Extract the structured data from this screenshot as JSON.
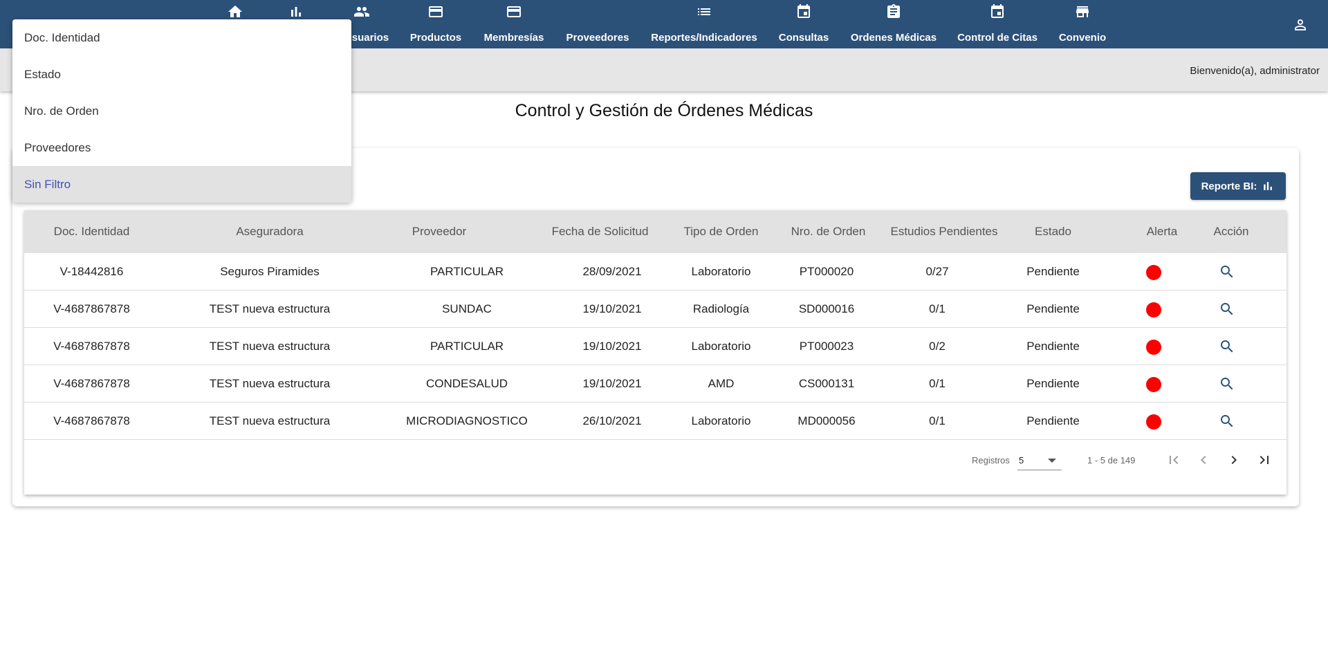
{
  "nav": {
    "items": [
      {
        "label": "",
        "icon": "home-icon"
      },
      {
        "label": "",
        "icon": "bar-chart-icon"
      },
      {
        "label": "Usuarios",
        "icon": "people-icon"
      },
      {
        "label": "Productos",
        "icon": "card-icon"
      },
      {
        "label": "Membresías",
        "icon": "card-icon"
      },
      {
        "label": "Proveedores",
        "icon": ""
      },
      {
        "label": "Reportes/Indicadores",
        "icon": "list-icon"
      },
      {
        "label": "Consultas",
        "icon": "calendar-icon"
      },
      {
        "label": "Ordenes Médicas",
        "icon": "clipboard-icon"
      },
      {
        "label": "Control de Citas",
        "icon": "calendar-icon"
      },
      {
        "label": "Convenio",
        "icon": "store-icon"
      }
    ],
    "user_icon": "person-icon"
  },
  "header": {
    "welcome": "Bienvenido(a), administrator"
  },
  "page": {
    "title": "Control y Gestión de Órdenes Médicas"
  },
  "toolbar": {
    "bi_label": "Reporte BI:"
  },
  "table": {
    "columns": [
      "Doc. Identidad",
      "Aseguradora",
      "Proveedor",
      "Fecha de Solicitud",
      "Tipo de Orden",
      "Nro. de Orden",
      "Estudios Pendientes",
      "Estado",
      "Alerta",
      "Acción"
    ],
    "rows": [
      {
        "doc": "V-18442816",
        "aseguradora": "Seguros Piramides",
        "proveedor": "PARTICULAR",
        "fecha": "28/09/2021",
        "tipo": "Laboratorio",
        "nro": "PT000020",
        "estudios": "0/27",
        "estado": "Pendiente"
      },
      {
        "doc": "V-4687867878",
        "aseguradora": "TEST nueva estructura",
        "proveedor": "SUNDAC",
        "fecha": "19/10/2021",
        "tipo": "Radiología",
        "nro": "SD000016",
        "estudios": "0/1",
        "estado": "Pendiente"
      },
      {
        "doc": "V-4687867878",
        "aseguradora": "TEST nueva estructura",
        "proveedor": "PARTICULAR",
        "fecha": "19/10/2021",
        "tipo": "Laboratorio",
        "nro": "PT000023",
        "estudios": "0/2",
        "estado": "Pendiente"
      },
      {
        "doc": "V-4687867878",
        "aseguradora": "TEST nueva estructura",
        "proveedor": "CONDESALUD",
        "fecha": "19/10/2021",
        "tipo": "AMD",
        "nro": "CS000131",
        "estudios": "0/1",
        "estado": "Pendiente"
      },
      {
        "doc": "V-4687867878",
        "aseguradora": "TEST nueva estructura",
        "proveedor": "MICRODIAGNOSTICO",
        "fecha": "26/10/2021",
        "tipo": "Laboratorio",
        "nro": "MD000056",
        "estudios": "0/1",
        "estado": "Pendiente"
      }
    ],
    "alert_color": "#ff0000"
  },
  "paginator": {
    "label": "Registros",
    "page_size": "5",
    "range": "1 - 5 de 149"
  },
  "filter_menu": {
    "options": [
      "Doc. Identidad",
      "Estado",
      "Nro. de Orden",
      "Proveedores",
      "Sin Filtro"
    ],
    "selected": "Sin Filtro"
  },
  "colors": {
    "brand": "#2c5179",
    "selected_text": "#3f51b5"
  }
}
